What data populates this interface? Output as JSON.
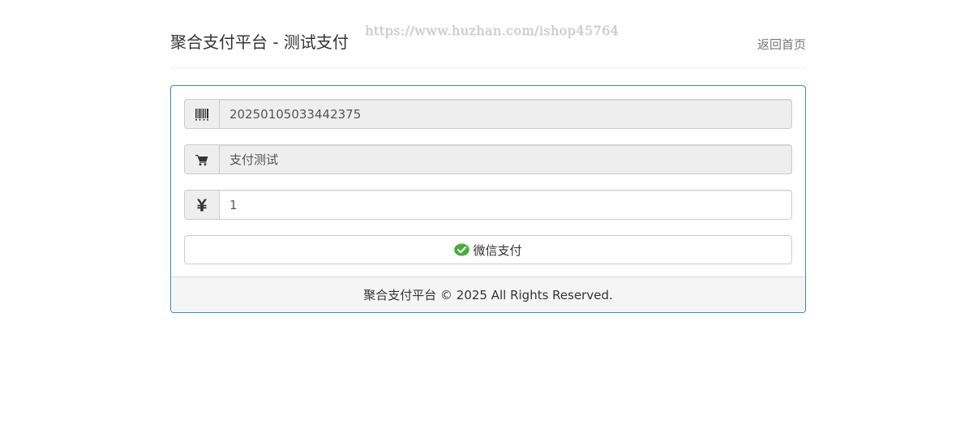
{
  "header": {
    "title": "聚合支付平台 - 测试支付",
    "watermark": "https://www.huzhan.com/ishop45764",
    "home_link": "返回首页"
  },
  "form": {
    "order_no": {
      "icon": "barcode-icon",
      "value": "20250105033442375",
      "readonly": true
    },
    "product_name": {
      "icon": "cart-icon",
      "value": "支付测试",
      "readonly": true
    },
    "amount": {
      "icon": "yen-icon",
      "value": "1",
      "readonly": false
    },
    "pay_button": {
      "icon": "wechat-icon",
      "label": "微信支付"
    }
  },
  "footer": {
    "text": "聚合支付平台 © 2025 All Rights Reserved."
  },
  "colors": {
    "panel_border": "#3c8dbc",
    "wechat_green": "#44b035",
    "addon_bg": "#eeeeee"
  }
}
